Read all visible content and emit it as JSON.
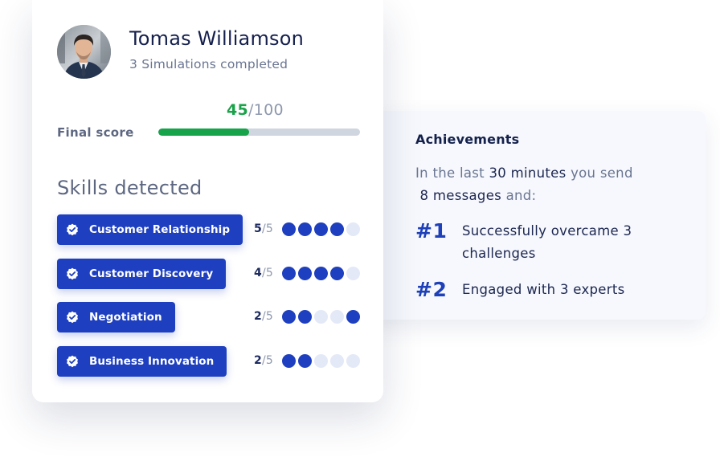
{
  "profile": {
    "name": "Tomas Williamson",
    "subtitle": "3 Simulations completed"
  },
  "score": {
    "value": "45",
    "slash": "/",
    "max": "100",
    "label": "Final score",
    "fraction": 0.45
  },
  "skills": {
    "heading": "Skills detected",
    "items": [
      {
        "label": "Customer Relationship",
        "score": "5",
        "out_of": "/5",
        "dots": [
          true,
          true,
          true,
          true,
          false
        ]
      },
      {
        "label": "Customer Discovery",
        "score": "4",
        "out_of": "/5",
        "dots": [
          true,
          true,
          true,
          true,
          false
        ]
      },
      {
        "label": "Negotiation",
        "score": "2",
        "out_of": "/5",
        "dots": [
          true,
          true,
          false,
          false,
          true
        ]
      },
      {
        "label": "Business Innovation",
        "score": "2",
        "out_of": "/5",
        "dots": [
          true,
          true,
          false,
          false,
          false
        ]
      }
    ]
  },
  "achievements": {
    "title": "Achievements",
    "intro_a": "In the last ",
    "intro_b": "30 minutes",
    "intro_c": " you send",
    "intro_d": "8 messages",
    "intro_e": " and:",
    "items": [
      {
        "rank": "#1",
        "text": "Successfully overcame 3 challenges"
      },
      {
        "rank": "#2",
        "text": "Engaged with 3 experts"
      }
    ]
  },
  "colors": {
    "accent_blue": "#1e3fbf",
    "score_green": "#16a34a",
    "dot_inactive": "#e4e9f8"
  },
  "icons": {
    "chip": "verified-badge-icon"
  }
}
